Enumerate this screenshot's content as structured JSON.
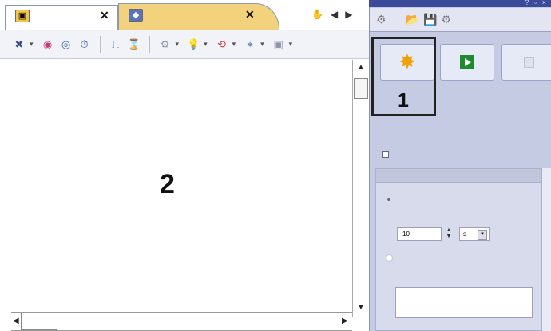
{
  "tabs": [
    {
      "icon": "scene-icon",
      "close_glyph": "✕"
    },
    {
      "icon": "object-icon",
      "close_glyph": "✕"
    }
  ],
  "tab_nav": {
    "hand": "✋",
    "prev": "◀",
    "next": "▶"
  },
  "toolbar": {
    "glyphs": {
      "pin": "✖",
      "globe": "◉",
      "eye": "◎",
      "timer": "⏱",
      "step": "⎍",
      "hourglass": "⌛",
      "gear": "⚙",
      "bulb": "💡",
      "arrows": "⟲",
      "target": "⌖",
      "screen": "▣"
    },
    "dropdown": "▾"
  },
  "canvas": {
    "callout": "2"
  },
  "scroll": {
    "up": "▲",
    "down": "▼",
    "left": "◀",
    "right": "▶"
  },
  "panel": {
    "titlebar_dots": "? ▫ ×",
    "tool_icons": [
      "folder-open-icon",
      "save-icon",
      "config-icon"
    ],
    "tool_glyphs": {
      "first": "⚙",
      "folder": "📂",
      "save": "💾",
      "config": "⚙"
    },
    "callout": "1",
    "start_glyph": "✸",
    "number_value": "10",
    "spin_up": "▲",
    "spin_down": "▼",
    "unit_value": "s",
    "unit_dd": "▼"
  }
}
